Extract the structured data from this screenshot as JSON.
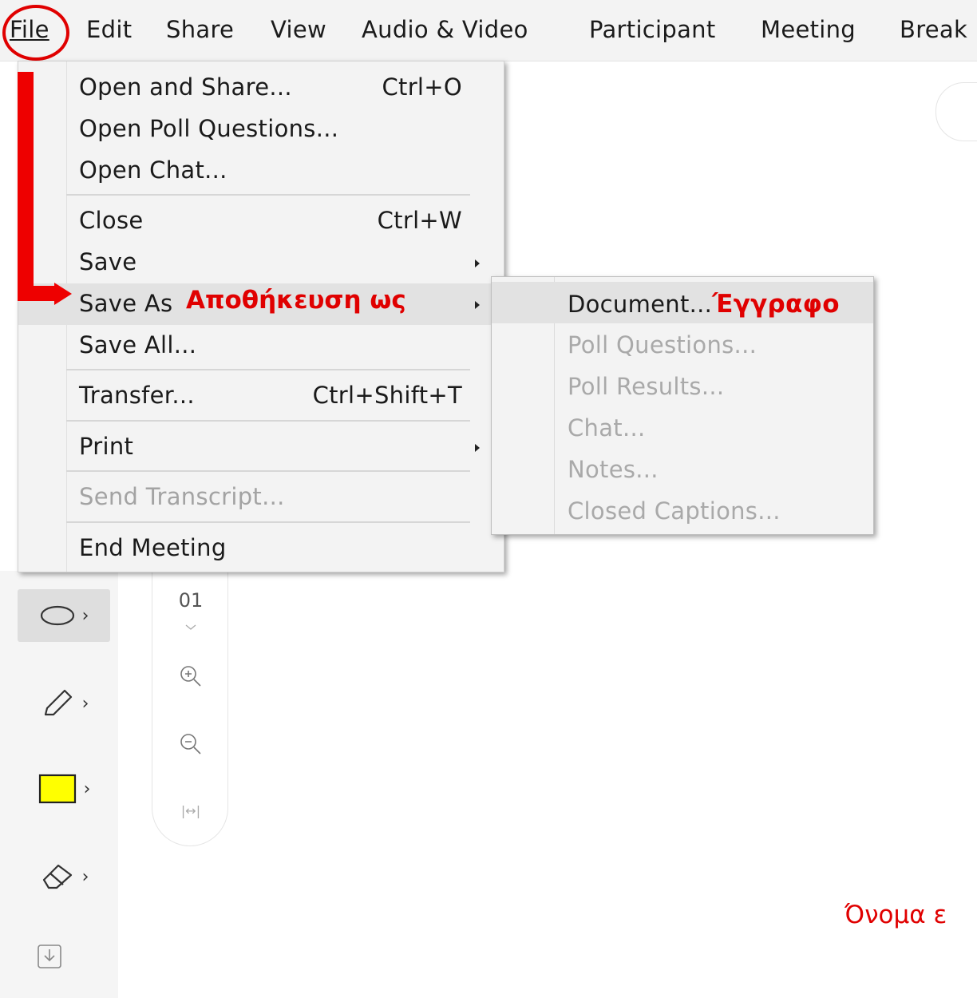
{
  "menubar": {
    "items": [
      "File",
      "Edit",
      "Share",
      "View",
      "Audio & Video",
      "Participant",
      "Meeting",
      "Break"
    ]
  },
  "file_menu": {
    "open_and_share": "Open and Share...",
    "open_and_share_shortcut": "Ctrl+O",
    "open_poll_questions": "Open Poll Questions...",
    "open_chat": "Open Chat...",
    "close": "Close",
    "close_shortcut": "Ctrl+W",
    "save": "Save",
    "save_as": "Save As",
    "save_all": "Save All...",
    "transfer": "Transfer...",
    "transfer_shortcut": "Ctrl+Shift+T",
    "print": "Print",
    "send_transcript": "Send Transcript...",
    "end_meeting": "End Meeting"
  },
  "save_as_submenu": {
    "document": "Document...",
    "poll_questions": "Poll Questions...",
    "poll_results": "Poll Results...",
    "chat": "Chat...",
    "notes": "Notes...",
    "closed_captions": "Closed Captions..."
  },
  "annotations": {
    "save_as_greek": "Αποθήκευση ως",
    "document_greek": "Έγγραφο",
    "filename_greek": "Όνομα ε"
  },
  "zoom_panel": {
    "page_number": "01",
    "fit_label": "|↔|"
  },
  "colors": {
    "annotation_red": "#e00000",
    "rectangle_tool_fill": "#ffff00",
    "menu_background": "#f3f3f3",
    "highlight": "#e2e2e2"
  }
}
